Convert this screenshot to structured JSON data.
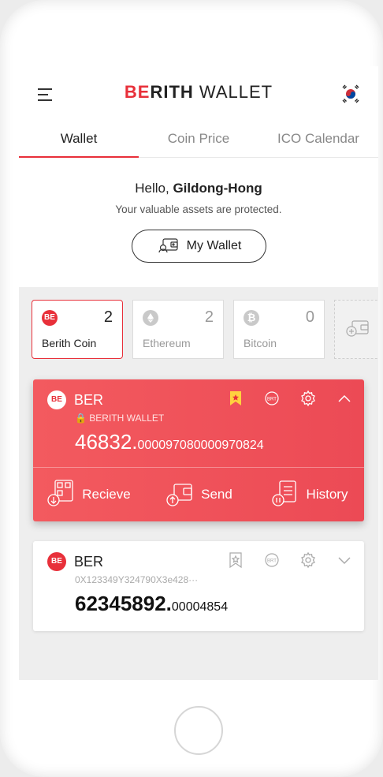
{
  "header": {
    "logo_brand": "BE",
    "logo_rest": "RITH",
    "logo_wallet": "WALLET",
    "menu_icon": "hamburger-icon",
    "flag_icon": "korea-flag-icon"
  },
  "tabs": [
    {
      "label": "Wallet",
      "active": true
    },
    {
      "label": "Coin Price",
      "active": false
    },
    {
      "label": "ICO Calendar",
      "active": false
    }
  ],
  "greeting": {
    "hello": "Hello,",
    "name": "Gildong-Hong",
    "subtitle": "Your valuable assets are protected.",
    "button": "My Wallet"
  },
  "coins": [
    {
      "name": "Berith Coin",
      "count": "2",
      "icon": "BE",
      "color": "#e8303a"
    },
    {
      "name": "Ethereum",
      "count": "2",
      "icon": "ethereum-icon",
      "color": "#c9c9c9"
    },
    {
      "name": "Bitcoin",
      "count": "0",
      "icon": "bitcoin-icon",
      "color": "#c9c9c9"
    }
  ],
  "cards": [
    {
      "logo": "BE",
      "name": "BER",
      "sub": "BERITH WALLET",
      "amount_int": "46832.",
      "amount_dec": "000097080000970824",
      "actions": [
        "Recieve",
        "Send",
        "History"
      ]
    },
    {
      "logo": "BE",
      "name": "BER",
      "sub": "0X123349Y324790X3e428···",
      "amount_int": "62345892.",
      "amount_dec": "00004854"
    }
  ],
  "colors": {
    "accent": "#e8303a",
    "card_red": "#f35a5f"
  }
}
